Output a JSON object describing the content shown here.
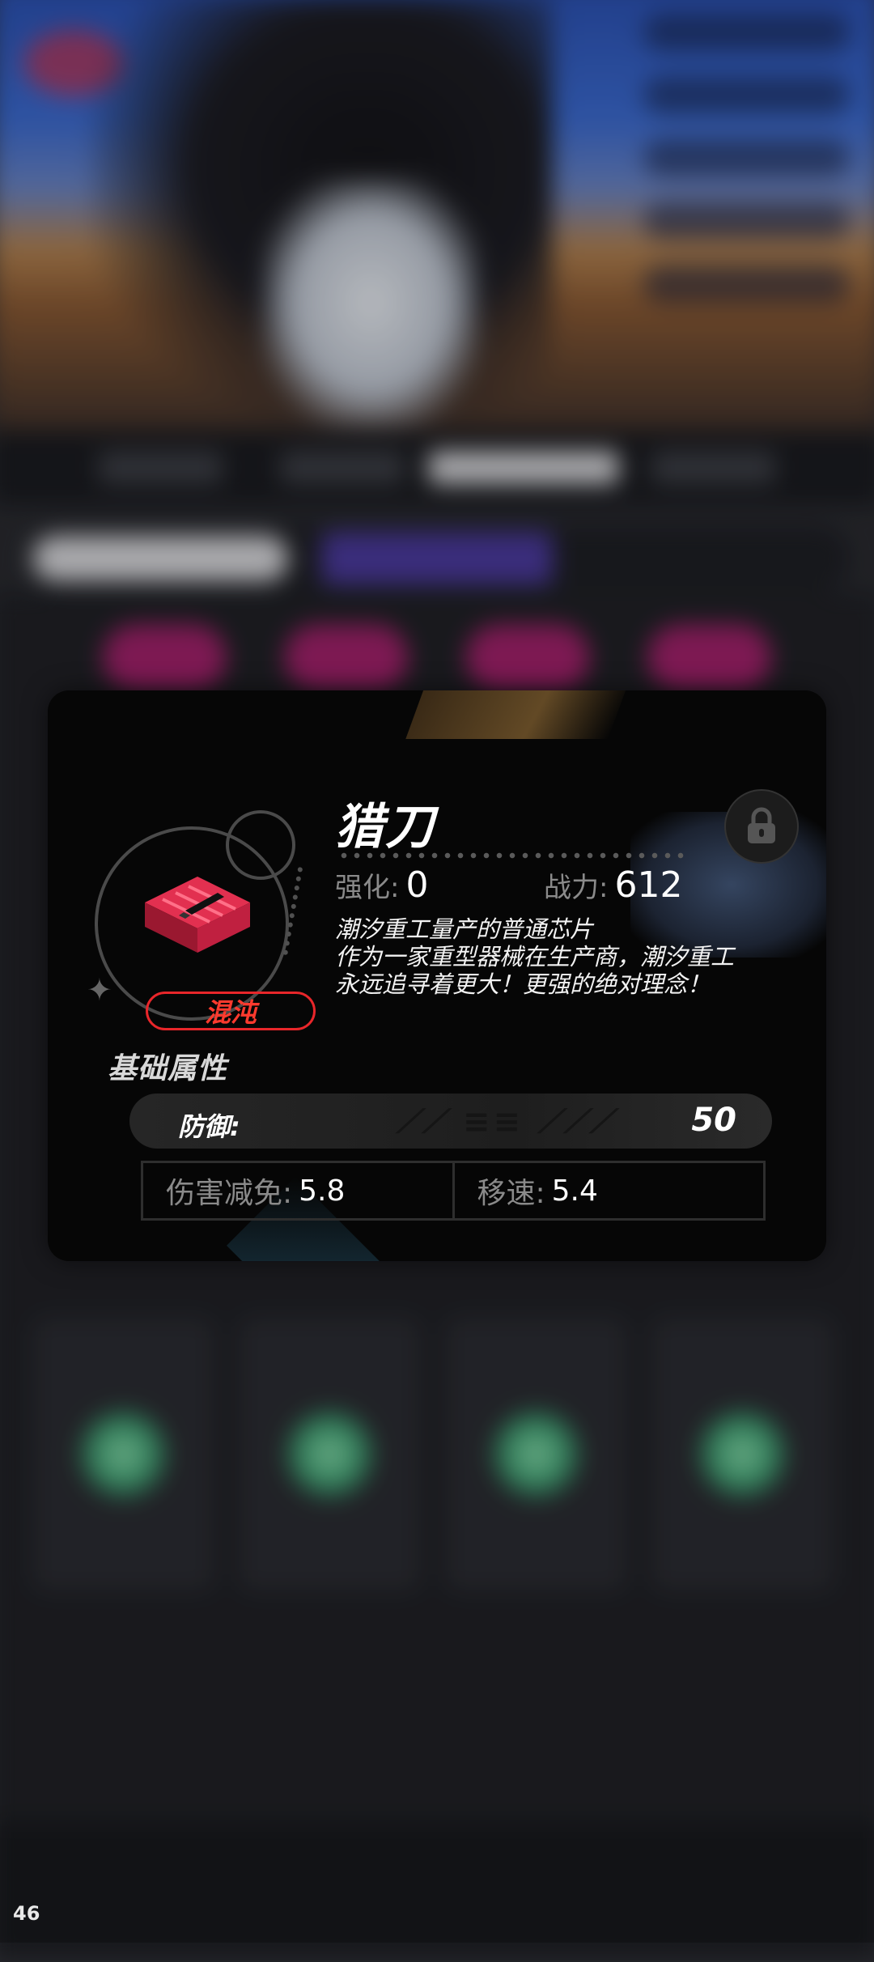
{
  "chip": {
    "name": "猎刀",
    "rarity": "混沌",
    "enhance_label": "强化:",
    "enhance_value": "0",
    "power_label": "战力:",
    "power_value": "612",
    "description": [
      "潮汐重工量产的普通芯片",
      "作为一家重型器械在生产商，潮汐重工",
      "永远追寻着更大！更强的绝对理念！"
    ],
    "icon": "red-chip-icon",
    "lock_icon": "lock-icon"
  },
  "attributes": {
    "title": "基础属性",
    "primary": {
      "label": "防御:",
      "value": "50"
    },
    "secondary": [
      {
        "label": "伤害减免:",
        "value": "5.8"
      },
      {
        "label": "移速:",
        "value": "5.4"
      }
    ]
  },
  "fps_counter": "46",
  "colors": {
    "rarity": "#e8262a",
    "card_bg": "#060606"
  }
}
